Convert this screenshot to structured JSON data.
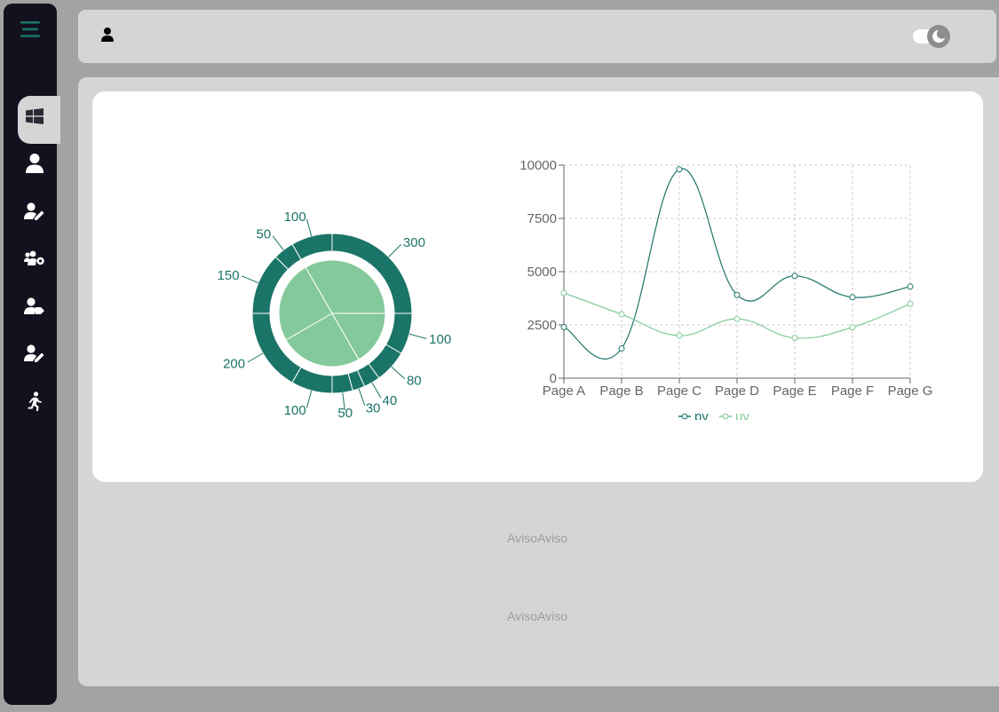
{
  "sidebar": {
    "menu_icon": "hamburger-icon",
    "items": [
      {
        "icon": "windows-icon",
        "active": true
      },
      {
        "icon": "user-icon",
        "active": false
      },
      {
        "icon": "user-edit-icon",
        "active": false
      },
      {
        "icon": "users-cog-icon",
        "active": false
      },
      {
        "icon": "user-tag-icon",
        "active": false
      },
      {
        "icon": "user-pen-icon",
        "active": false
      },
      {
        "icon": "running-icon",
        "active": false
      }
    ]
  },
  "topbar": {
    "user_icon": "user-icon",
    "theme_toggle_icon": "moon-icon"
  },
  "colors": {
    "primary": "#1b7468",
    "secondary": "#84c99b",
    "sidebar_bg": "#12121f",
    "panel_bg": "#d6d5d6"
  },
  "chart_data": [
    {
      "type": "pie",
      "inner": {
        "values": [
          400,
          300,
          300,
          200
        ]
      },
      "outer": {
        "values": [
          300,
          100,
          50,
          150,
          200,
          100,
          50,
          30,
          40,
          80,
          100
        ]
      },
      "labels": [
        "300",
        "100",
        "50",
        "150",
        "200",
        "100",
        "50",
        "30",
        "40",
        "80",
        "100"
      ]
    },
    {
      "type": "line",
      "categories": [
        "Page A",
        "Page B",
        "Page C",
        "Page D",
        "Page E",
        "Page F",
        "Page G"
      ],
      "series": [
        {
          "name": "pv",
          "values": [
            2400,
            1398,
            9800,
            3908,
            4800,
            3800,
            4300
          ]
        },
        {
          "name": "uv",
          "values": [
            4000,
            3000,
            2000,
            2780,
            1890,
            2390,
            3490
          ]
        }
      ],
      "yticks": [
        "0",
        "2500",
        "5000",
        "7500",
        "10000"
      ],
      "ylim": [
        0,
        10000
      ],
      "grid": true,
      "legend": "bottom"
    }
  ],
  "notices": [
    "AvisoAviso",
    "AvisoAviso"
  ]
}
